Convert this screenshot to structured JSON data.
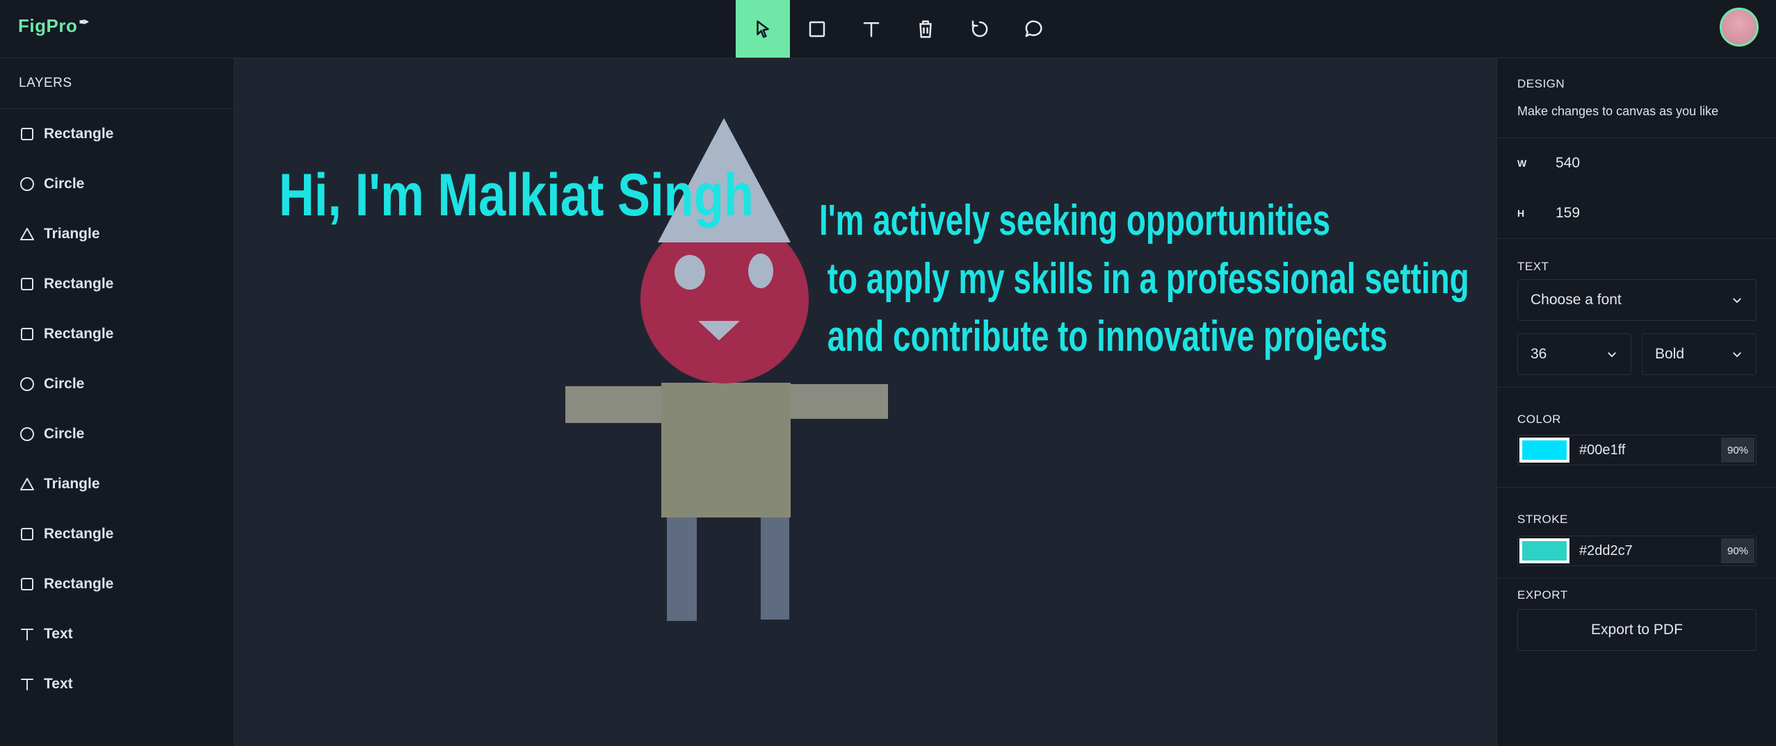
{
  "app": {
    "logo": "FigPro",
    "accent": "#6ee7a7"
  },
  "toolbar": {
    "tools": [
      {
        "name": "select",
        "icon": "cursor-icon",
        "active": true
      },
      {
        "name": "rectangle",
        "icon": "square-icon"
      },
      {
        "name": "text",
        "icon": "text-icon"
      },
      {
        "name": "delete",
        "icon": "trash-icon"
      },
      {
        "name": "reset",
        "icon": "rotate-icon"
      },
      {
        "name": "comments",
        "icon": "comment-icon"
      }
    ]
  },
  "layers": {
    "title": "LAYERS",
    "items": [
      {
        "label": "Rectangle",
        "icon": "square-icon"
      },
      {
        "label": "Circle",
        "icon": "circle-icon"
      },
      {
        "label": "Triangle",
        "icon": "triangle-icon"
      },
      {
        "label": "Rectangle",
        "icon": "square-icon"
      },
      {
        "label": "Rectangle",
        "icon": "square-icon"
      },
      {
        "label": "Circle",
        "icon": "circle-icon"
      },
      {
        "label": "Circle",
        "icon": "circle-icon"
      },
      {
        "label": "Triangle",
        "icon": "triangle-icon"
      },
      {
        "label": "Rectangle",
        "icon": "square-icon"
      },
      {
        "label": "Rectangle",
        "icon": "square-icon"
      },
      {
        "label": "Text",
        "icon": "text-icon"
      },
      {
        "label": "Text",
        "icon": "text-icon"
      }
    ]
  },
  "canvas": {
    "headline": "Hi, I'm Malkiat Singh",
    "lines": [
      "I'm actively seeking opportunities",
      " to apply my skills in a professional setting",
      " and contribute to innovative projects"
    ],
    "text_color": "#1de3e3"
  },
  "design": {
    "title": "DESIGN",
    "subtitle": "Make changes to canvas as you like",
    "width_label": "W",
    "width_value": "540",
    "height_label": "H",
    "height_value": "159",
    "text_title": "TEXT",
    "font_placeholder": "Choose a font",
    "font_size": "36",
    "font_weight": "Bold",
    "color_title": "COLOR",
    "fill_hex": "#00e1ff",
    "fill_opacity": "90%",
    "stroke_title": "STROKE",
    "stroke_hex": "#2dd2c7",
    "stroke_opacity": "90%",
    "export_title": "EXPORT",
    "export_label": "Export to PDF"
  }
}
